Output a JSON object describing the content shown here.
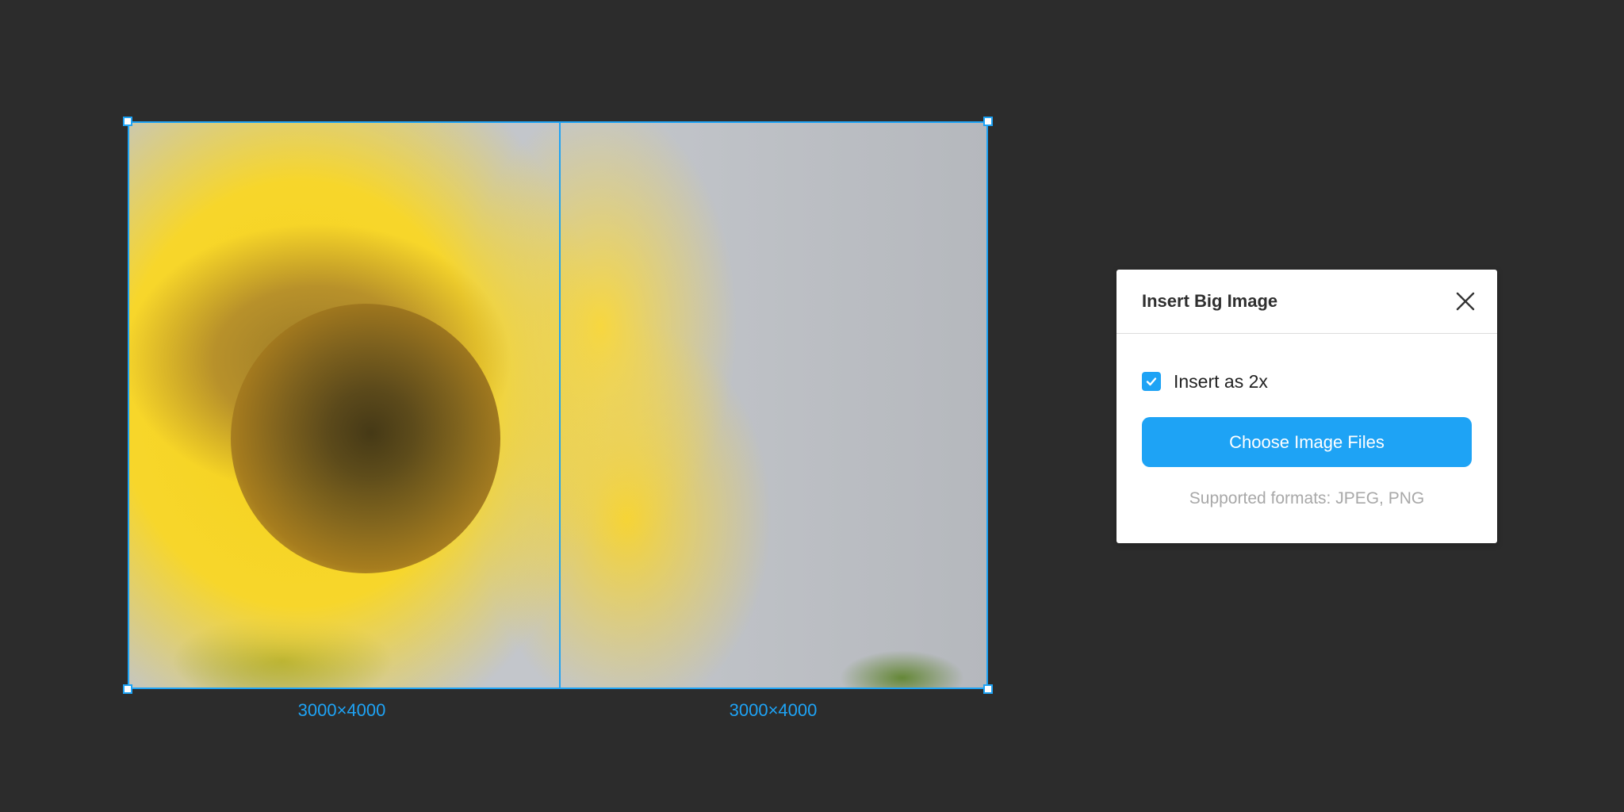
{
  "canvas": {
    "background": "#2c2c2c",
    "accent": "#1ea3f5",
    "images": [
      {
        "dimensions_label": "3000×4000"
      },
      {
        "dimensions_label": "3000×4000"
      }
    ]
  },
  "dialog": {
    "title": "Insert Big Image",
    "close_icon": "close-icon",
    "checkbox": {
      "label": "Insert as 2x",
      "checked": true
    },
    "choose_button_label": "Choose Image Files",
    "supported_formats": "Supported formats: JPEG, PNG"
  }
}
